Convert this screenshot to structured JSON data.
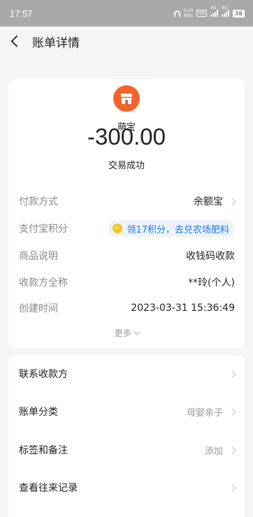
{
  "status_bar": {
    "time": "17:57",
    "speed_value": "0.50",
    "speed_unit": "KB/s",
    "hd_label": "HD",
    "network_1": "4G",
    "network_2": "4G",
    "battery": "38"
  },
  "nav": {
    "title": "账单详情"
  },
  "transaction": {
    "merchant": "萌宝",
    "amount": "-300.00",
    "status": "交易成功"
  },
  "details": {
    "payment_method_label": "付款方式",
    "payment_method_value": "余额宝",
    "points_label": "支付宝积分",
    "points_value": "领17积分，去兑农场肥料",
    "product_label": "商品说明",
    "product_value": "收钱码收款",
    "payee_label": "收款方全称",
    "payee_value": "**玲(个人)",
    "created_label": "创建时间",
    "created_value": "2023-03-31 15:36:49",
    "more_label": "更多"
  },
  "actions": {
    "contact_label": "联系收款方",
    "category_label": "账单分类",
    "category_value": "母婴亲子",
    "tags_label": "标签和备注",
    "tags_value": "添加",
    "history_label": "查看往来记录"
  },
  "colors": {
    "accent": "#1677ff",
    "merchant_icon": "#f0652b",
    "coin": "#f5c518"
  }
}
